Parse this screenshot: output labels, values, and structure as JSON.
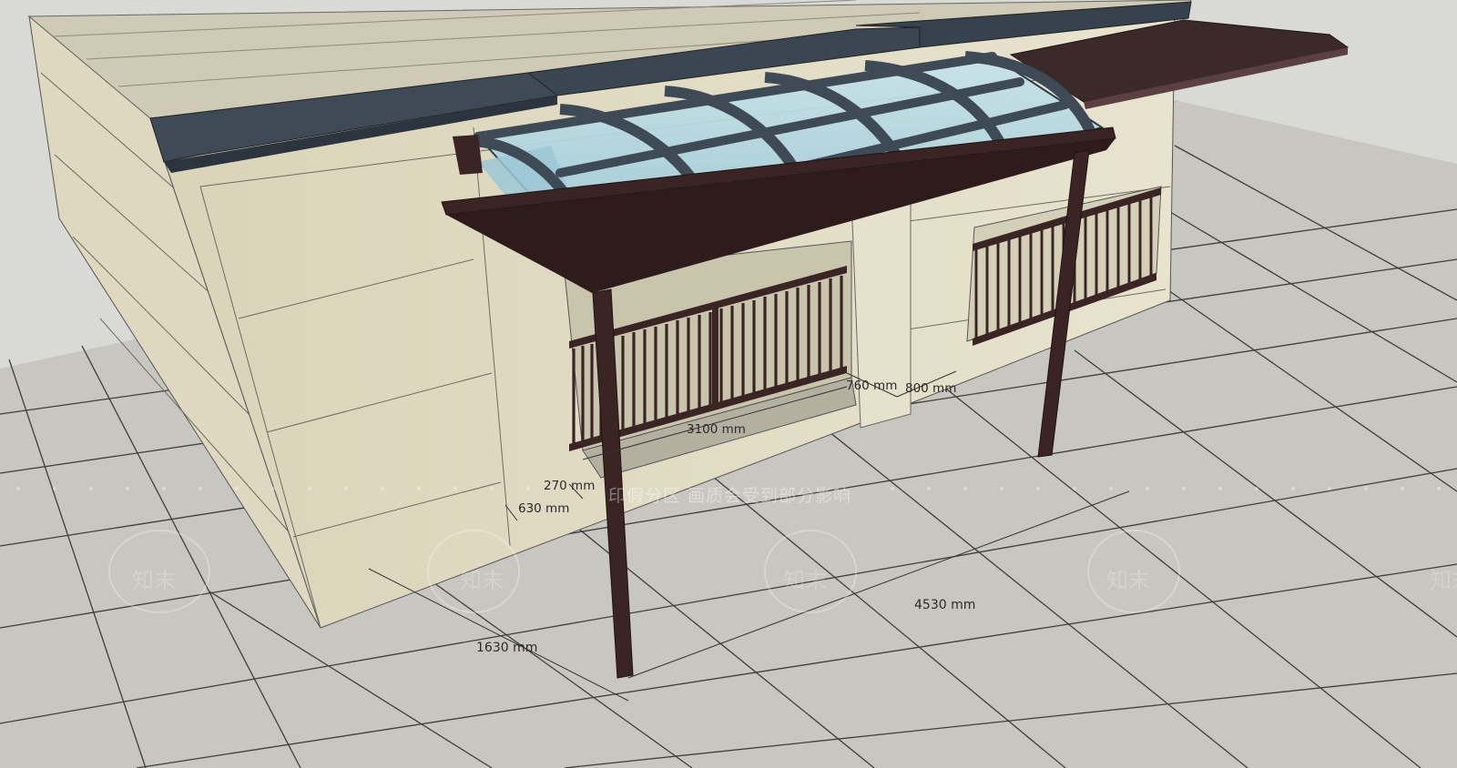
{
  "dimensions": {
    "depth_post": "1630 mm",
    "beam_span": "4530 mm",
    "balcony_width": "3100 mm",
    "wall_step_a": "760 mm",
    "wall_step_b": "800 mm",
    "offset_small": "270 mm",
    "offset_large": "630 mm"
  },
  "watermark": {
    "notice": "印假分区 画质会受到部分影响",
    "logo": "知末"
  },
  "colors": {
    "floor": "#c9c7c1",
    "floor_grid": "#3b3b3b",
    "wall_light": "#e4dfc8",
    "wall_shade": "#d5cfb4",
    "roof_trim": "#3e4a55",
    "frame": "#3a2424",
    "glass": "#a9d0dc"
  }
}
